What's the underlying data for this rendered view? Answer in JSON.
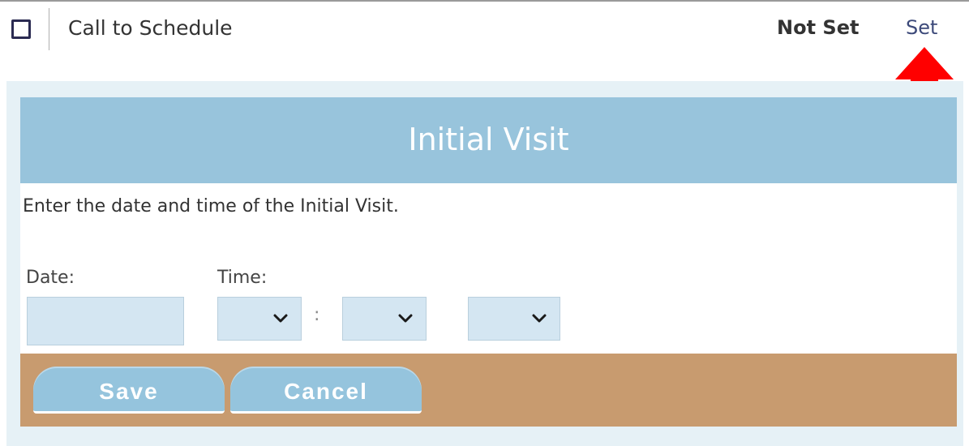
{
  "task_row": {
    "label": "Call to Schedule",
    "status": "Not Set",
    "action": "Set",
    "checked": false
  },
  "dialog": {
    "title": "Initial Visit",
    "instructions": "Enter the date and time of the Initial Visit.",
    "date_label": "Date:",
    "time_label": "Time:",
    "date_value": "",
    "hour_value": "",
    "minute_value": "",
    "ampm_value": "",
    "time_separator": ":",
    "save_label": "Save",
    "cancel_label": "Cancel"
  },
  "icons": {
    "arrow": "arrow-up-icon",
    "dropdown": "chevron-down-icon"
  },
  "colors": {
    "header": "#98c4dc",
    "footer": "#c89b6f",
    "button": "#95c4dd",
    "input": "#d4e6f2",
    "arrow": "#ff0000"
  }
}
